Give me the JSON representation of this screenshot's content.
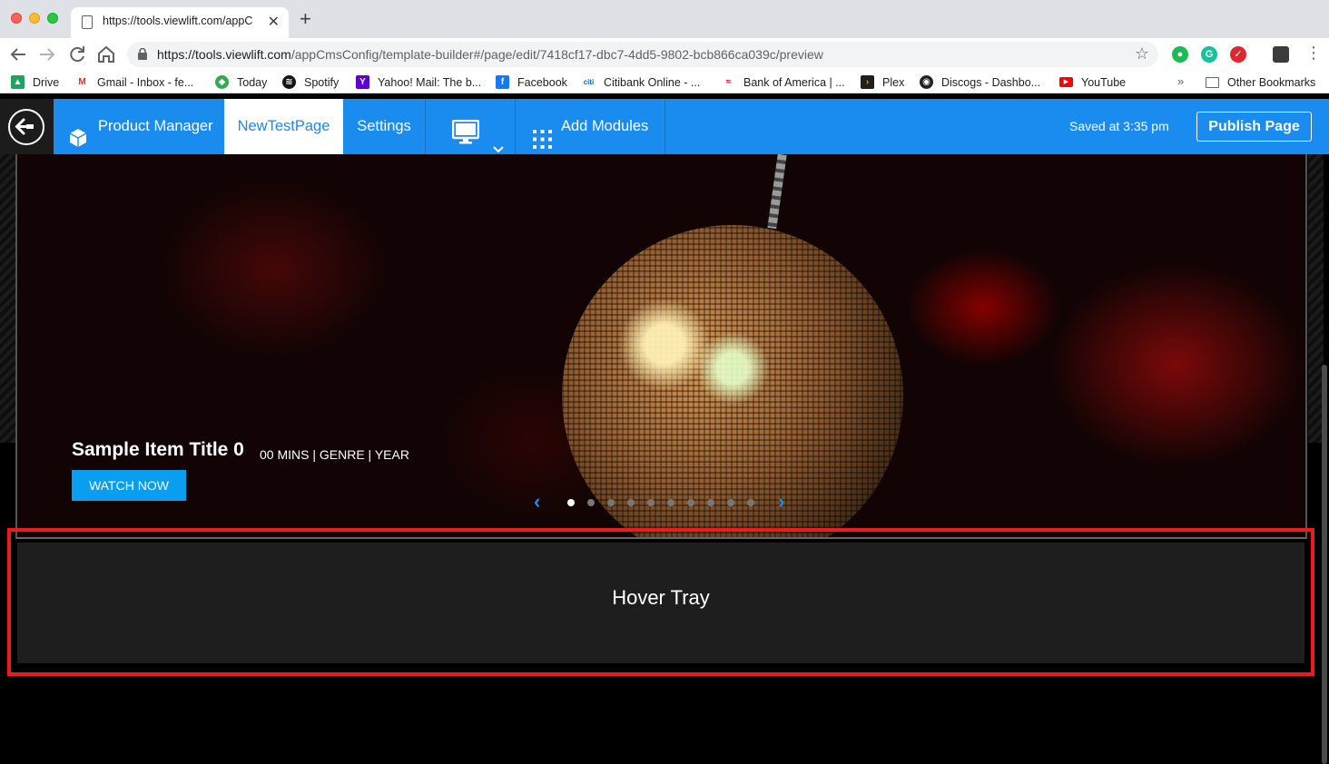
{
  "browser": {
    "tab_title": "https://tools.viewlift.com/appC",
    "tab_close": "✕",
    "new_tab": "+",
    "url_host": "https://tools.viewlift.com",
    "url_path": "/appCmsConfig/template-builder#/page/edit/7418cf17-dbc7-4dd5-9802-bcb866ca039c/preview"
  },
  "bookmarks": [
    {
      "label": "Drive",
      "icon": "drive-icon",
      "color": "#1ea362"
    },
    {
      "label": "Gmail - Inbox - fe...",
      "icon": "gmail-icon",
      "color": "#d93025"
    },
    {
      "label": "Today",
      "icon": "today-icon",
      "color": "#34a853"
    },
    {
      "label": "Spotify",
      "icon": "spotify-icon",
      "color": "#191414"
    },
    {
      "label": "Yahoo! Mail: The b...",
      "icon": "yahoo-icon",
      "color": "#5f01d1"
    },
    {
      "label": "Facebook",
      "icon": "facebook-icon",
      "color": "#1877f2"
    },
    {
      "label": "Citibank Online - ...",
      "icon": "citi-icon",
      "color": "#056dae"
    },
    {
      "label": "Bank of America | ...",
      "icon": "bofa-icon",
      "color": "#c41230"
    },
    {
      "label": "Plex",
      "icon": "plex-icon",
      "color": "#e5a00d"
    },
    {
      "label": "Discogs - Dashbo...",
      "icon": "discogs-icon",
      "color": "#222222"
    },
    {
      "label": "YouTube",
      "icon": "youtube-icon",
      "color": "#ff0000"
    }
  ],
  "bookmarks_more": "»",
  "other_bookmarks": "Other Bookmarks",
  "app": {
    "brand": "Product Manager",
    "active_page": "NewTestPage",
    "settings": "Settings",
    "add_modules": "Add Modules",
    "saved_status": "Saved at 3:35 pm",
    "publish": "Publish Page",
    "accent_color": "#1a8cf0"
  },
  "hero": {
    "title": "Sample Item Title 0",
    "meta": "00 MINS | GENRE | YEAR",
    "watch_now": "WATCH NOW",
    "carousel_total": 10,
    "carousel_active": 0,
    "prev": "‹",
    "next": "›"
  },
  "tray": {
    "label": "Hover Tray",
    "highlight_color": "#ee1b1b"
  }
}
